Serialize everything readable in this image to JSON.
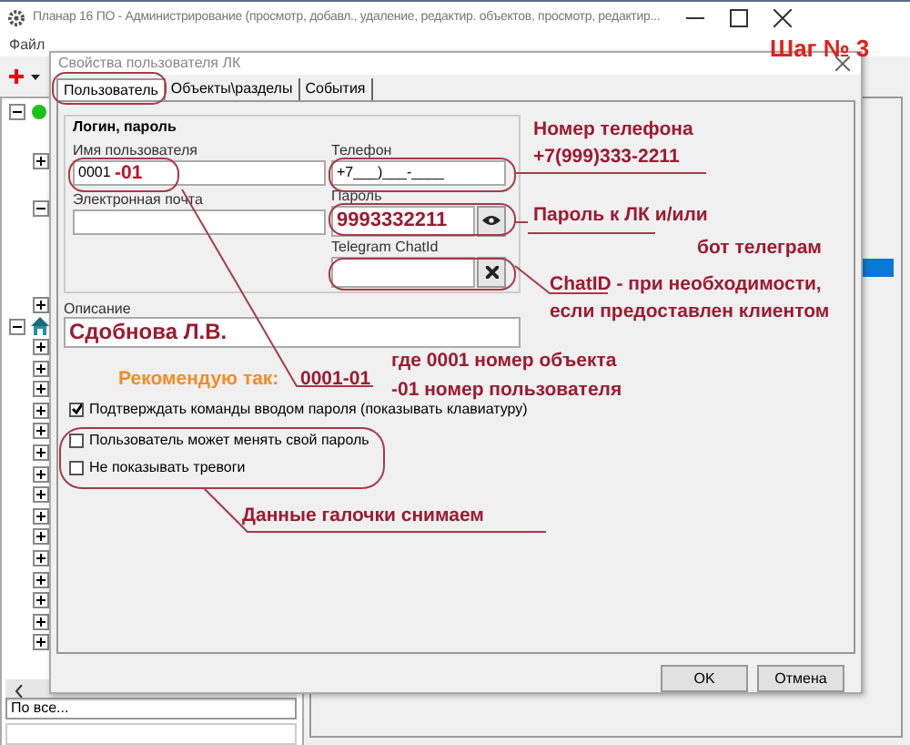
{
  "app_window": {
    "title": "Планар 16 ПО - Администрирование (просмотр, добавл., удаление, редактир. объектов,  просмотр, редактир...",
    "menu": [
      "Файл"
    ],
    "filter_combo": "По все..."
  },
  "tree": [
    {
      "kind": "status",
      "expanded": true,
      "children": [
        {
          "expanded": false
        },
        {
          "expanded": true
        },
        {
          "expanded": false
        }
      ]
    },
    {
      "kind": "building",
      "expanded": true,
      "children": [
        {
          "expanded": false
        },
        {
          "expanded": false
        },
        {
          "expanded": false
        },
        {
          "expanded": false
        },
        {
          "expanded": false
        },
        {
          "expanded": false
        },
        {
          "expanded": false
        },
        {
          "expanded": false
        },
        {
          "expanded": false
        },
        {
          "expanded": false
        },
        {
          "expanded": false
        },
        {
          "expanded": false
        },
        {
          "expanded": false
        },
        {
          "expanded": false
        },
        {
          "expanded": false
        }
      ]
    }
  ],
  "dialog": {
    "title": "Свойства пользователя ЛК",
    "tabs": [
      {
        "label": "Пользователь",
        "selected": true
      },
      {
        "label": "Объекты\\разделы",
        "selected": false
      },
      {
        "label": "События",
        "selected": false
      }
    ],
    "group_title": "Логин, пароль",
    "username": {
      "label": "Имя пользователя",
      "value": "0001"
    },
    "phone": {
      "label": "Телефон",
      "value": "+7___)___-____"
    },
    "email": {
      "label": "Электронная почта"
    },
    "password": {
      "label": "Пароль",
      "value": "9993332211"
    },
    "telegram": {
      "label": "Telegram ChatId"
    },
    "description": {
      "label": "Описание",
      "value": "Сдобнова Л.В."
    },
    "checkboxes": [
      {
        "label": "Подтверждать команды вводом пароля (показывать клавиатуру)",
        "checked": true
      },
      {
        "label": "Пользователь может менять свой пароль",
        "checked": false
      },
      {
        "label": "Не показывать тревоги",
        "checked": false
      }
    ],
    "buttons": [
      "OK",
      "Отмена"
    ]
  },
  "annotations": {
    "step": "Шаг № 3",
    "notes": [
      {
        "text": "Номер телефона",
        "color": "#9b1b30"
      },
      {
        "text": "+7(999)333-2211",
        "color": "#9b1b30"
      },
      {
        "text": "-01",
        "color": "#c0102a"
      },
      {
        "text": "Пароль к ЛК и/или",
        "color": "#9b1b30"
      },
      {
        "text": "бот  телеграм",
        "color": "#9b1b30"
      },
      {
        "text": "ChatID - при необходимости,",
        "color": "#9b1b30"
      },
      {
        "text": "если предоставлен клиентом",
        "color": "#9b1b30"
      },
      {
        "text": "где 0001 номер объекта",
        "color": "#9b1b30"
      },
      {
        "text": "Рекомендую так:",
        "color": "#f28c28"
      },
      {
        "text": "0001-01",
        "color": "#9b1b30"
      },
      {
        "text": "-01 номер пользователя",
        "color": "#9b1b30"
      },
      {
        "text": "Данные галочки снимаем",
        "color": "#9b1b30"
      }
    ]
  }
}
